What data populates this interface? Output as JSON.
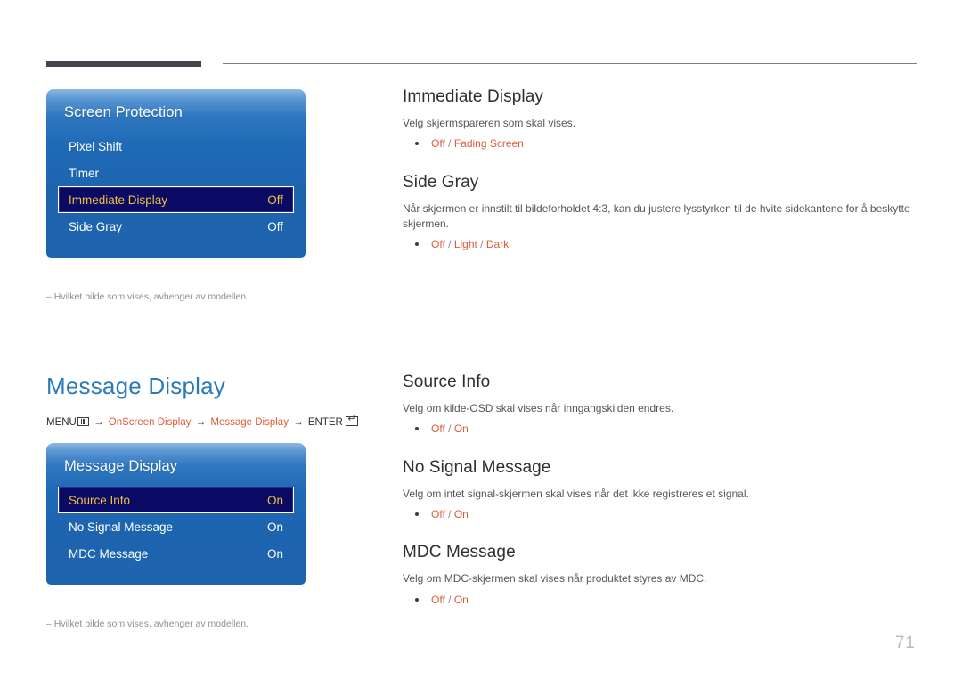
{
  "page": {
    "number": "71"
  },
  "sections": [
    {
      "id": "screen-protection",
      "osd": {
        "title": "Screen Protection",
        "rows": [
          {
            "label": "Pixel Shift",
            "value": "",
            "selected": false
          },
          {
            "label": "Timer",
            "value": "",
            "selected": false
          },
          {
            "label": "Immediate Display",
            "value": "Off",
            "selected": true
          },
          {
            "label": "Side Gray",
            "value": "Off",
            "selected": false
          }
        ]
      },
      "footnote": "Hvilket bilde som vises, avhenger av modellen.",
      "footnote_dash": "–",
      "topics": [
        {
          "title": "Immediate Display",
          "desc": "Velg skjermspareren som skal vises.",
          "options": [
            "Off",
            "Fading Screen"
          ]
        },
        {
          "title": "Side Gray",
          "desc": "Når skjermen er innstilt til bildeforholdet 4:3, kan du justere lysstyrken til de hvite sidekantene for å beskytte skjermen.",
          "options": [
            "Off",
            "Light",
            "Dark"
          ]
        }
      ]
    },
    {
      "id": "message-display",
      "heading": "Message Display",
      "breadcrumb": {
        "menu_label": "MENU",
        "menu_icon": "menu-grid-icon",
        "arrow": "→",
        "links": [
          "OnScreen Display",
          "Message Display"
        ],
        "enter_label": "ENTER",
        "enter_icon": "enter-key-icon"
      },
      "osd": {
        "title": "Message Display",
        "rows": [
          {
            "label": "Source Info",
            "value": "On",
            "selected": true
          },
          {
            "label": "No Signal Message",
            "value": "On",
            "selected": false
          },
          {
            "label": "MDC Message",
            "value": "On",
            "selected": false
          }
        ]
      },
      "footnote": "Hvilket bilde som vises, avhenger av modellen.",
      "footnote_dash": "–",
      "topics": [
        {
          "title": "Source Info",
          "desc": "Velg om kilde-OSD skal vises når inngangskilden endres.",
          "options": [
            "Off",
            "On"
          ]
        },
        {
          "title": "No Signal Message",
          "desc": "Velg om intet signal-skjermen skal vises når det ikke registreres et signal.",
          "options": [
            "Off",
            "On"
          ]
        },
        {
          "title": "MDC Message",
          "desc": "Velg om MDC-skjermen skal vises når produktet styres av MDC.",
          "options": [
            "Off",
            "On"
          ]
        }
      ]
    }
  ],
  "colors": {
    "accent_orange": "#e05a38",
    "heading_blue": "#2a7ab8",
    "osd_blue": "#1f69b5",
    "osd_selected_bg": "#0a0a64",
    "osd_selected_text": "#f0c040",
    "rule_dark": "#46424f"
  }
}
